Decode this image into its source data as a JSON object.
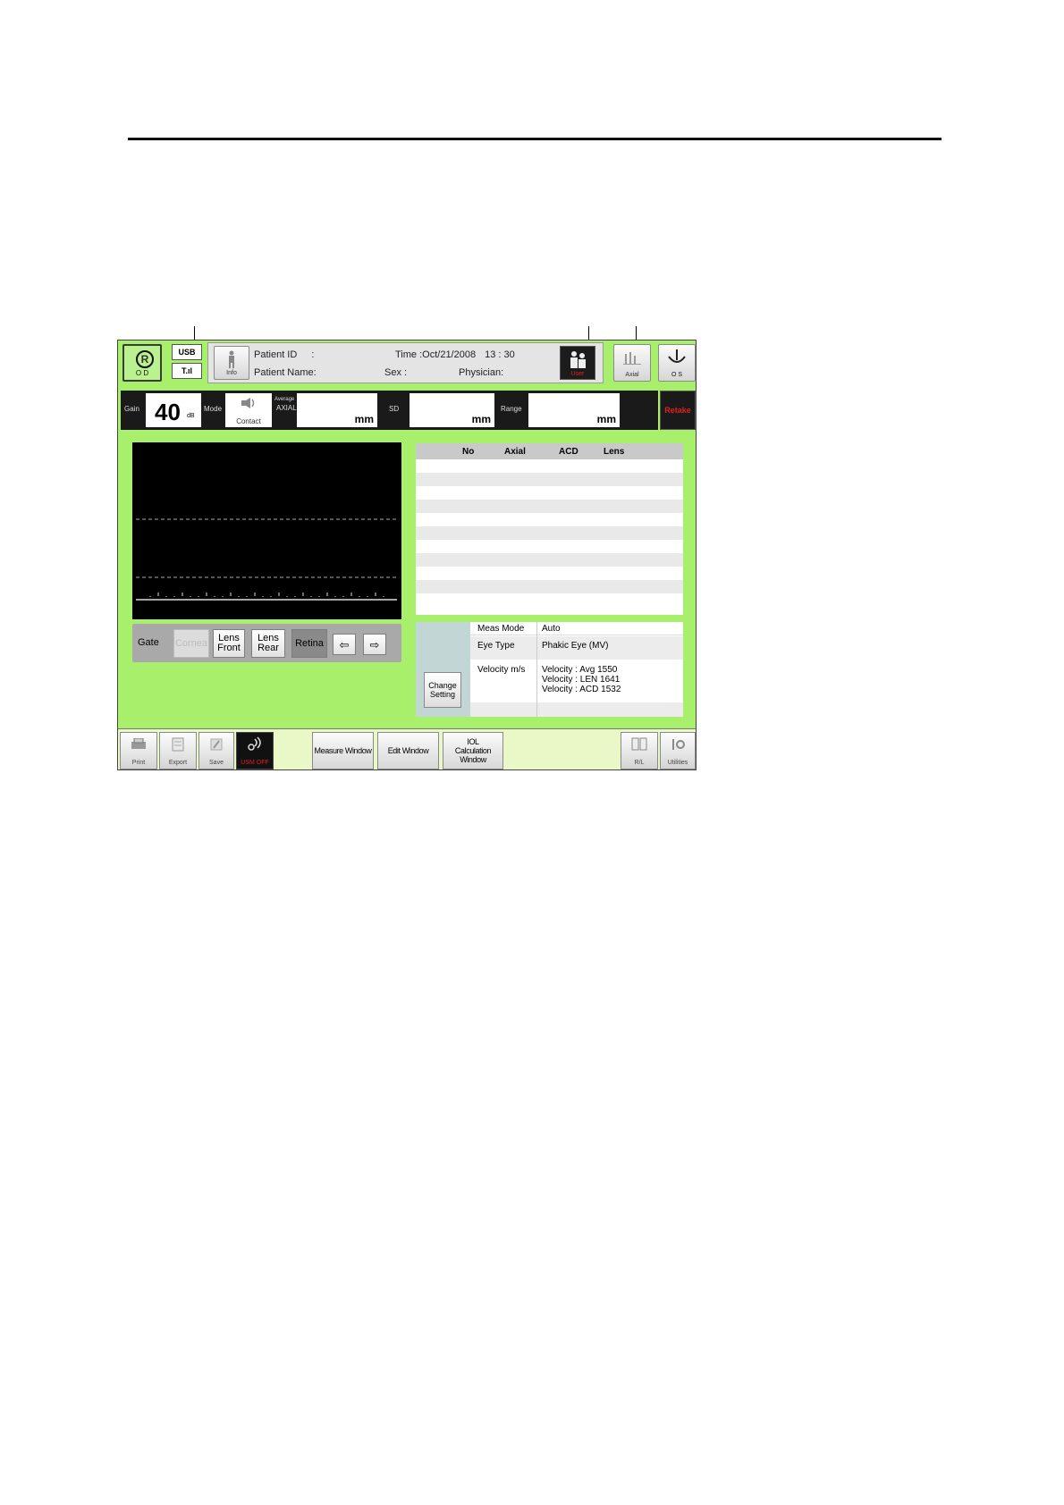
{
  "top_bar": {
    "eye_left_label": "O D",
    "eye_left_symbol": "R",
    "usb_label": "USB",
    "signal_label": "T.ıl",
    "info_label": "Info",
    "patient_id_label": "Patient ID",
    "patient_id_sep": ":",
    "patient_name_label": "Patient Name:",
    "time_label": "Time :",
    "time_value": "Oct/21/2008",
    "time_clock": "13 : 30",
    "sex_label": "Sex :",
    "physician_label": "Physician:",
    "user_icon_caption": "User",
    "axial_label": "Axial",
    "eye_right_label": "O S"
  },
  "measure_strip": {
    "gain_label": "Gain",
    "gain_value": "40",
    "gain_unit": "dB",
    "mode_label": "Mode",
    "mode_value": "Contact",
    "average_label": "Average",
    "axial_label": "AXIAL",
    "axial_unit": "mm",
    "sd_label": "SD",
    "sd_unit": "mm",
    "range_label": "Range",
    "range_unit": "mm",
    "retake_label": "Retake"
  },
  "gate": {
    "label": "Gate",
    "buttons": [
      {
        "label": "Cornea",
        "state": "disabled"
      },
      {
        "label": "Lens Front",
        "state": "normal"
      },
      {
        "label": "Lens Rear",
        "state": "normal"
      },
      {
        "label": "Retina",
        "state": "selected"
      }
    ],
    "left_arrow": "⇦",
    "right_arrow": "⇨"
  },
  "results_table": {
    "columns": [
      "No",
      "Axial",
      "ACD",
      "Lens"
    ]
  },
  "settings": {
    "change_button_line1": "Change",
    "change_button_line2": "Setting",
    "meas_mode_label": "Meas Mode",
    "meas_mode_value": "Auto",
    "eye_type_label": "Eye Type",
    "eye_type_value": "Phakic Eye (MV)",
    "velocity_label": "Velocity m/s",
    "velocity_lines": [
      "Velocity : Avg 1550",
      "Velocity :  LEN 1641",
      "Velocity :  ACD 1532"
    ]
  },
  "bottom_bar": {
    "print_label": "Print",
    "export_label": "Export",
    "save_label": "Save",
    "usm_label": "USM OFF",
    "measure_window_label": "Measure Window",
    "edit_window_label": "Edit Window",
    "iol_line1": "IOL",
    "iol_line2": "Calculation",
    "iol_line3": "Window",
    "rl_label": "R/L",
    "utilities_label": "Utilities"
  },
  "colors": {
    "screen_bg": "#a8f06c",
    "retake_text": "#e02020",
    "user_caption": "#e02020"
  }
}
